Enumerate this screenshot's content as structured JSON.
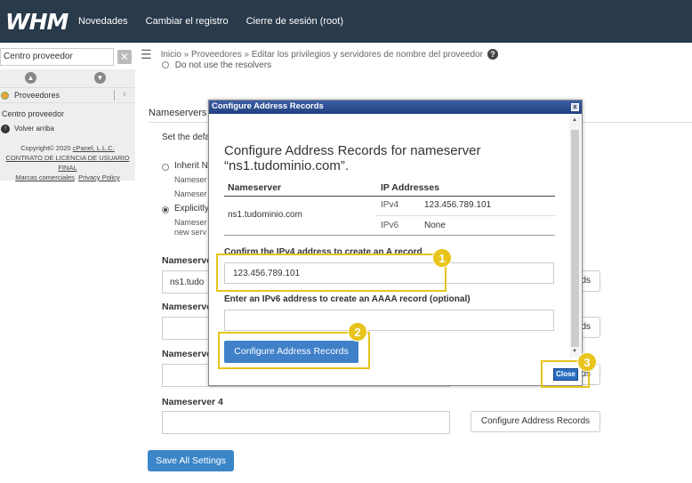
{
  "app": {
    "logo": "WHM"
  },
  "topnav": [
    "Novedades",
    "Cambiar el registro",
    "Cierre de sesión (root)"
  ],
  "sidebar": {
    "search_value": "Centro proveedor",
    "section": "Proveedores",
    "item": "Centro proveedor",
    "back": "Volver arriba",
    "copyright": "Copyright© 2020",
    "company": "cPanel, L.L.C.",
    "license": "CONTRATO DE LICENCIA DE USUARIO FINAL",
    "trademarks": "Marcas comerciales",
    "privacy": "Privacy Policy"
  },
  "breadcrumb": {
    "home": "Inicio",
    "sep": "»",
    "providers": "Proveedores",
    "page": "Editar los privilegios y servidores de nombre del proveedor"
  },
  "main": {
    "clipped_option": "Do not use the resolvers",
    "nameservers_label": "Nameservers",
    "set_default": "Set the default",
    "inherit": "Inherit N",
    "inherit_sub1": "Nameser",
    "inherit_sub2": "Nameser",
    "explicit": "Explicitly",
    "explicit_sub1": "Nameser",
    "explicit_sub2": "new serv",
    "ns1_label": "Nameserver",
    "ns1_value": "ns1.tudo",
    "ns2_label": "Nameserver",
    "ns3_label": "Nameserver",
    "ns4_label": "Nameserver 4",
    "cfg_btn_1": "ds",
    "cfg_btn_2": "ds",
    "cfg_btn_3": "ds",
    "cfg_btn_4": "Configure Address Records",
    "save": "Save All Settings"
  },
  "modal": {
    "title": "Configure Address Records",
    "close_x": "x",
    "heading": "Configure Address Records for nameserver “ns1.tudominio.com”.",
    "col_ns": "Nameserver",
    "col_ip": "IP Addresses",
    "ns": "ns1.tudominio.com",
    "ipv4_label": "IPv4",
    "ipv4": "123.456.789.101",
    "ipv6_label": "IPv6",
    "ipv6": "None",
    "confirm_label": "Confirm the IPv4 address to create an A record",
    "confirm_value": "123.456.789.101",
    "aaaa_label": "Enter an IPv6 address to create an AAAA record (optional)",
    "aaaa_value": "",
    "submit": "Configure Address Records",
    "close": "Close"
  },
  "badges": [
    "1",
    "2",
    "3"
  ],
  "colors": {
    "topbar": "#293a4a",
    "primary": "#3b86c8",
    "highlight": "#e8c41c"
  }
}
